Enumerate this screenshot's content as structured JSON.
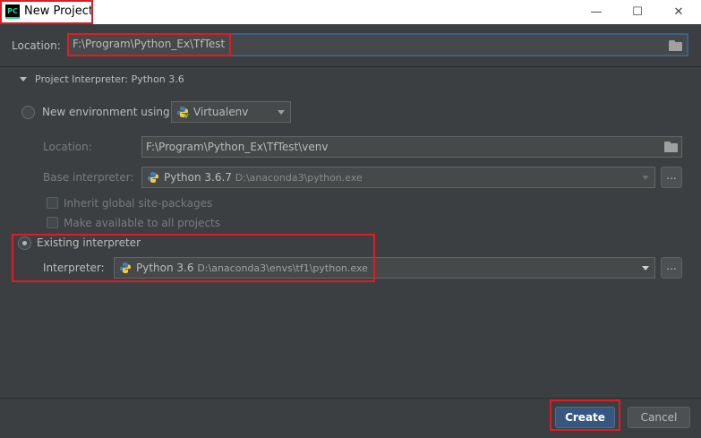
{
  "window": {
    "title": "New Project",
    "app_icon_text": "PC",
    "minimize_glyph": "—",
    "maximize_glyph": "☐",
    "close_glyph": "✕"
  },
  "location": {
    "label": "Location:",
    "value": "F:\\Program\\Python_Ex\\TfTest"
  },
  "interpreter_section": {
    "header": "Project Interpreter: Python 3.6",
    "new_env": {
      "label": "New environment using",
      "tool": "Virtualenv",
      "location_label": "Location:",
      "location_value": "F:\\Program\\Python_Ex\\TfTest\\venv",
      "base_label": "Base interpreter:",
      "base_version": "Python 3.6.7",
      "base_path": "D:\\anaconda3\\python.exe",
      "inherit_label": "Inherit global site-packages",
      "make_available_label": "Make available to all projects"
    },
    "existing": {
      "label": "Existing interpreter",
      "interpreter_label": "Interpreter:",
      "interpreter_version": "Python 3.6",
      "interpreter_path": "D:\\anaconda3\\envs\\tf1\\python.exe"
    },
    "browse_label": "..."
  },
  "footer": {
    "create_label": "Create",
    "cancel_label": "Cancel"
  },
  "colors": {
    "background": "#3c3f41",
    "highlight": "#e01b24",
    "primary_button": "#365880"
  }
}
